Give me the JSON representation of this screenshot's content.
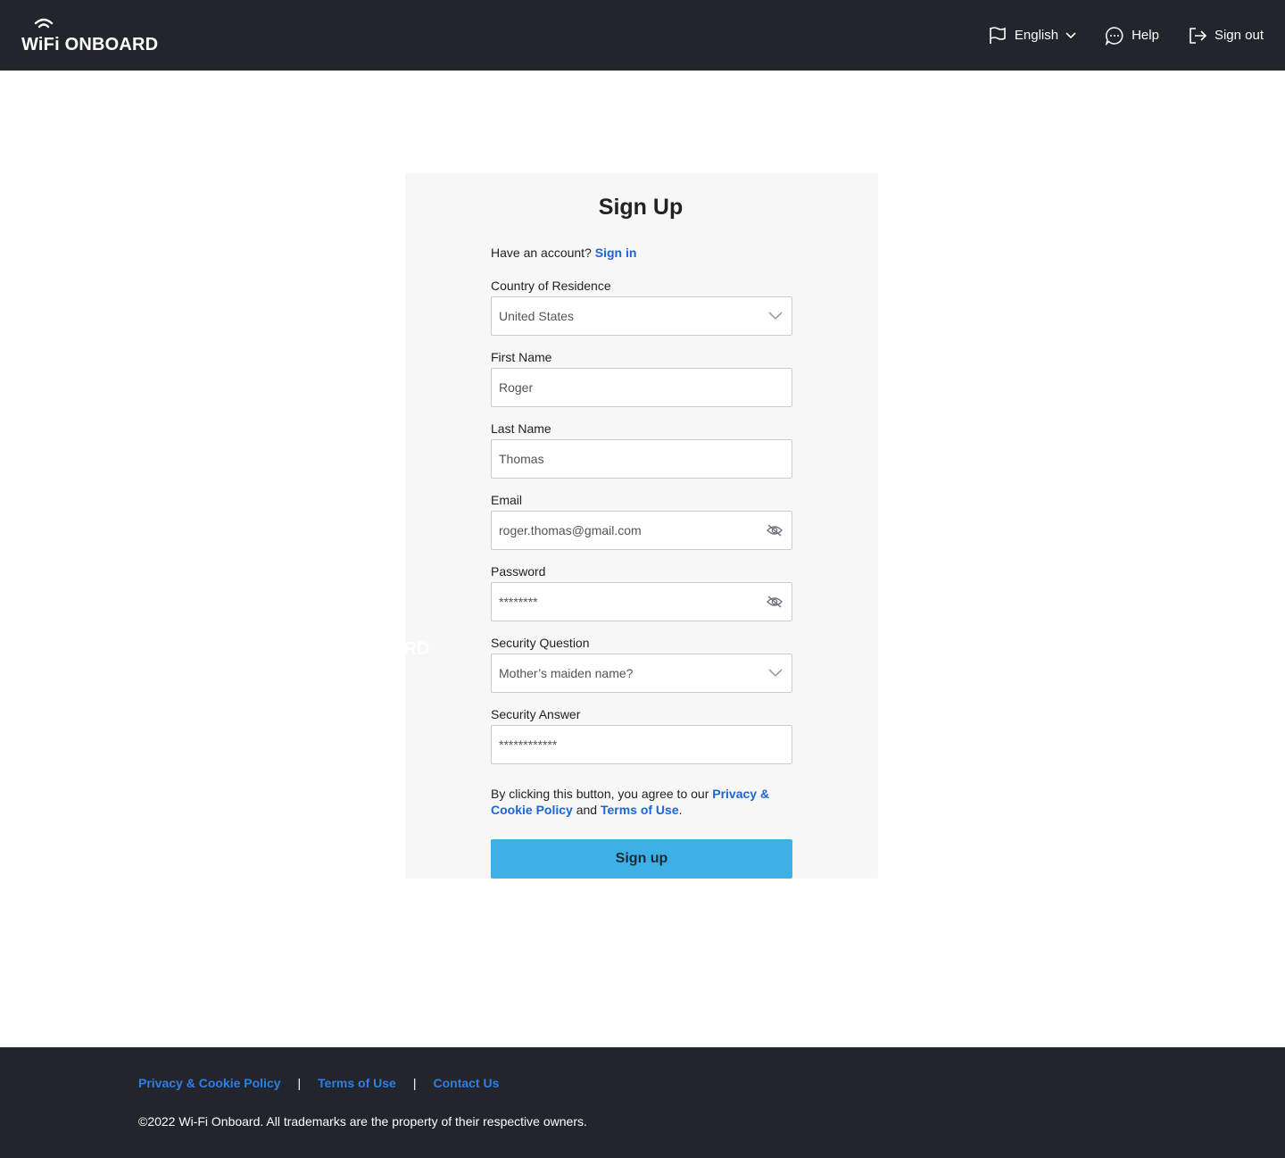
{
  "header": {
    "logo_text": "WiFi ONBOARD",
    "language_label": "English",
    "help_label": "Help",
    "signout_label": "Sign out"
  },
  "card": {
    "title": "Sign Up",
    "have_account_text": "Have an account?",
    "signin_link": "Sign in",
    "country_label": "Country of Residence",
    "country_value": "United States",
    "first_name_label": "First Name",
    "first_name_value": "Roger",
    "last_name_label": "Last Name",
    "last_name_value": "Thomas",
    "email_label": "Email",
    "email_value": "roger.thomas@gmail.com",
    "password_label": "Password",
    "password_value": "********",
    "security_question_label": "Security Question",
    "security_question_value": "Mother’s maiden name?",
    "security_answer_label": "Security Answer",
    "security_answer_value": "************",
    "terms_prefix": "By clicking this button, you agree to our",
    "terms_privacy_link": "Privacy & Cookie Policy",
    "terms_and": "and",
    "terms_use_link": "Terms of Use",
    "terms_suffix": ".",
    "signup_button": "Sign up"
  },
  "ghost_text": "ONBOARD",
  "footer": {
    "privacy_link": "Privacy & Cookie Policy",
    "separator": "|",
    "terms_link": "Terms of Use",
    "contact_link": "Contact Us",
    "copyright": "©2022 Wi-Fi Onboard.  All trademarks are the property of their respective owners."
  },
  "colors": {
    "header_bg": "#22252b",
    "link": "#1a66d9",
    "button": "#3eb0e6",
    "card_bg": "#f7f7f7"
  }
}
